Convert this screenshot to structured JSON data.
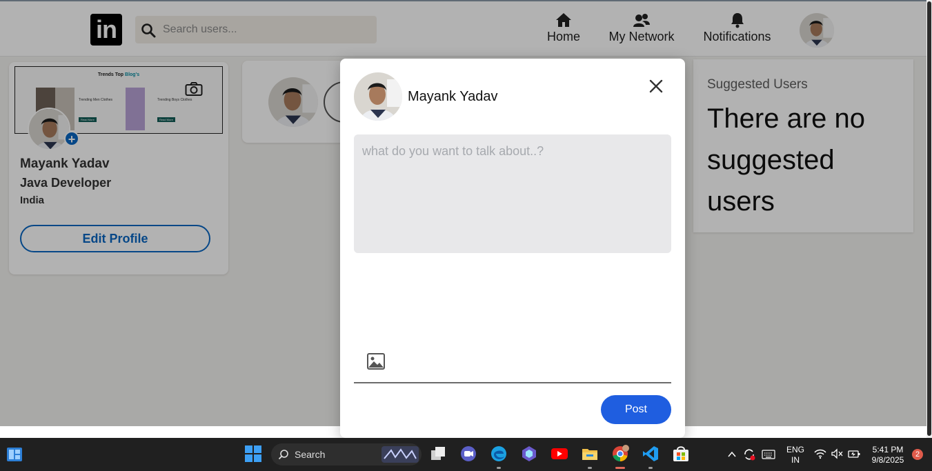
{
  "navbar": {
    "logo_text": "in",
    "search_placeholder": "Search users...",
    "items": [
      {
        "label": "Home",
        "icon": "home-icon"
      },
      {
        "label": "My Network",
        "icon": "network-icon"
      },
      {
        "label": "Notifications",
        "icon": "bell-icon"
      }
    ]
  },
  "profile": {
    "cover_title": "Trends Top",
    "cover_title_highlight": "Blog's",
    "cover_items": [
      "Trending Men Clothes",
      "Trending Boys Clothes"
    ],
    "cover_button": "Read More",
    "name": "Mayank Yadav",
    "headline": "Java Developer",
    "location": "India",
    "edit_label": "Edit Profile"
  },
  "suggested": {
    "heading": "Suggested Users",
    "empty_message": "There are no suggested users"
  },
  "modal": {
    "user_name": "Mayank Yadav",
    "textarea_placeholder": "what do you want to talk about..?",
    "post_label": "Post"
  },
  "taskbar": {
    "search_label": "Search",
    "lang_line1": "ENG",
    "lang_line2": "IN",
    "time": "5:41 PM",
    "date": "9/8/2025",
    "notification_count": "2"
  },
  "colors": {
    "accent": "#0a66c2",
    "post_button": "#1f5ee0",
    "taskbar": "#202020"
  }
}
